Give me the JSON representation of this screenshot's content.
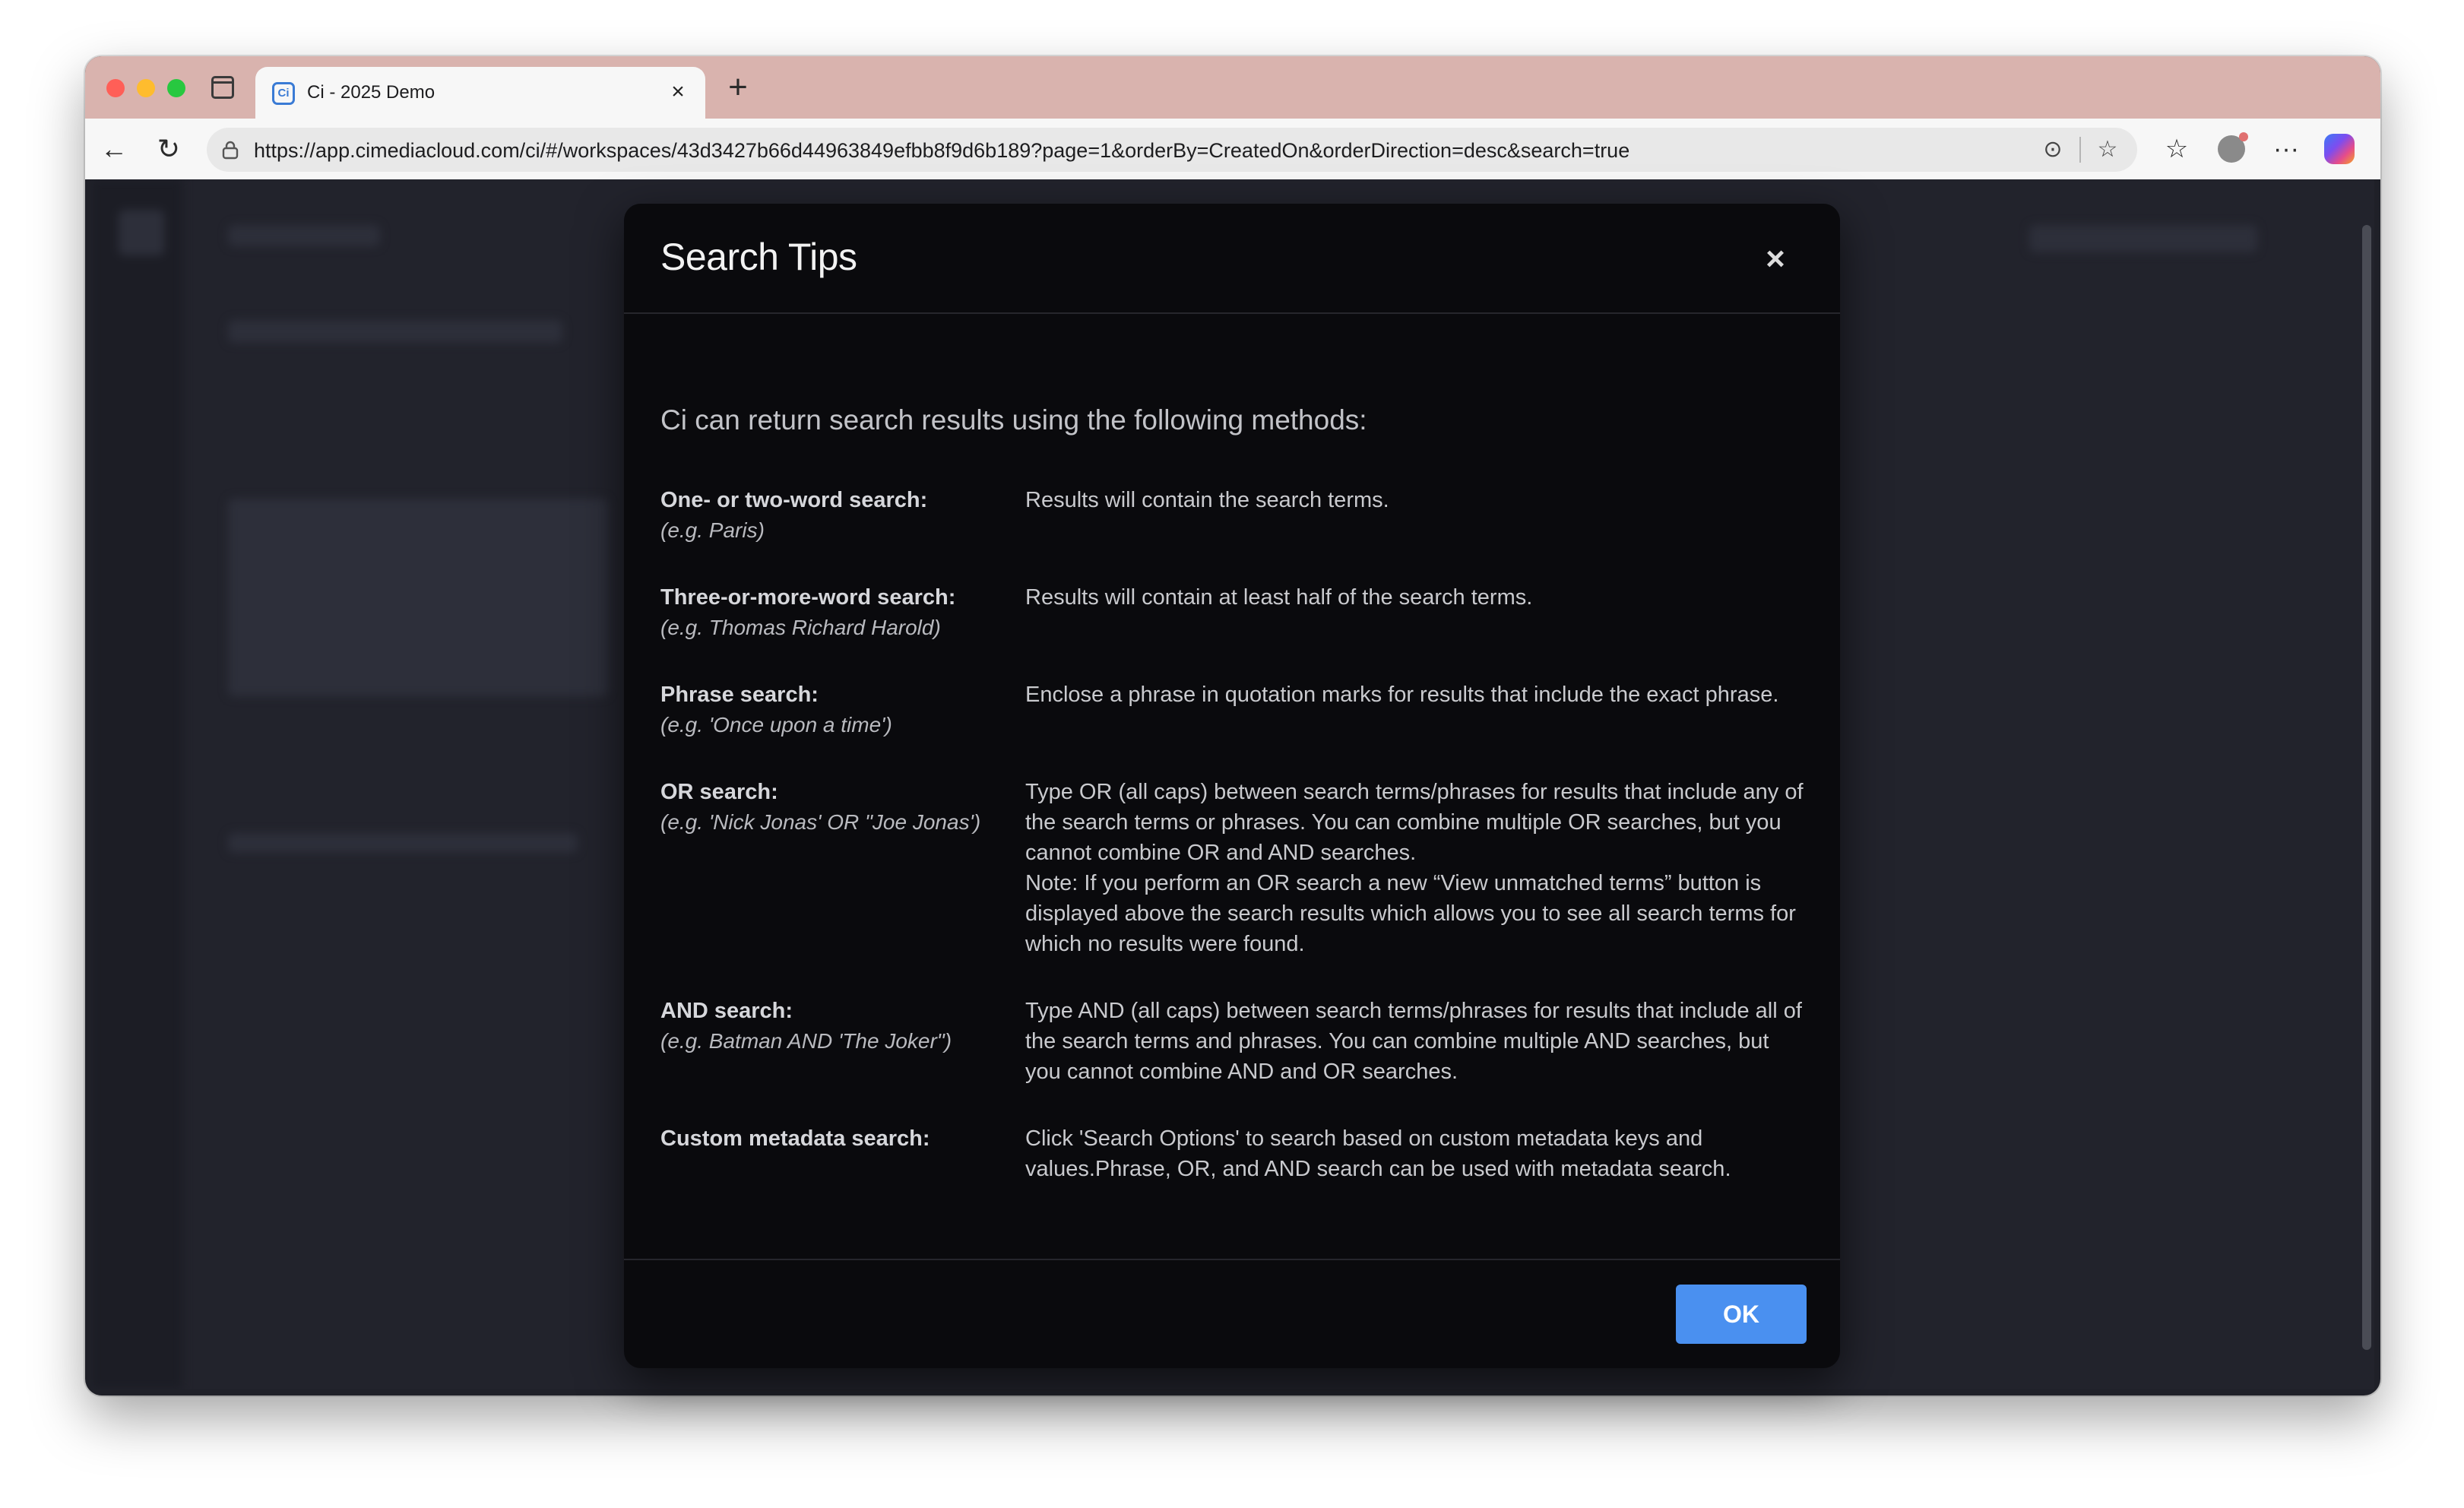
{
  "browser": {
    "tab_title": "Ci - 2025 Demo",
    "tab_favicon_letter": "Ci",
    "tab_close": "×",
    "new_tab": "+",
    "back": "←",
    "reload": "↻",
    "url": "https://app.cimediacloud.com/ci/#/workspaces/43d3427b66d44963849efbb8f9d6b189?page=1&orderBy=CreatedOn&orderDirection=desc&search=true",
    "reader_icon": "⊙",
    "star_icon": "☆",
    "favorites_icon": "☆",
    "more_icon": "···"
  },
  "modal": {
    "title": "Search Tips",
    "close": "×",
    "intro": "Ci can return search results using the following methods:",
    "tips": [
      {
        "label": "One- or two-word search:",
        "example": "(e.g. Paris)",
        "description": "Results will contain the search terms."
      },
      {
        "label": "Three-or-more-word search:",
        "example": "(e.g. Thomas Richard Harold)",
        "description": "Results will contain at least half of the search terms."
      },
      {
        "label": "Phrase search:",
        "example": "(e.g. 'Once upon a time')",
        "description": "Enclose a phrase in quotation marks for results that include the exact phrase."
      },
      {
        "label": "OR search:",
        "example": "(e.g. 'Nick Jonas' OR \"Joe Jonas')",
        "description": "Type OR (all caps) between search terms/phrases for results that include any of the search terms or phrases. You can combine multiple OR searches, but you cannot combine OR and AND searches.",
        "note": "Note: If you perform an OR search a new “View unmatched terms” button is displayed above the search results which allows you to see all search terms for which no results were found."
      },
      {
        "label": "AND search:",
        "example": "(e.g. Batman AND 'The Joker\")",
        "description": "Type AND (all caps) between search terms/phrases for results that include all of the search terms and phrases. You can combine multiple AND searches, but you cannot combine AND and OR searches."
      },
      {
        "label": "Custom metadata search:",
        "example": "",
        "description": "Click 'Search Options' to search based on custom metadata keys and values.Phrase, OR, and AND search can be used with metadata search."
      }
    ],
    "ok_label": "OK"
  },
  "colors": {
    "tabstrip": "#d9b3ae",
    "modal_bg": "#0a0a0d",
    "ok_button": "#4a90f0"
  }
}
